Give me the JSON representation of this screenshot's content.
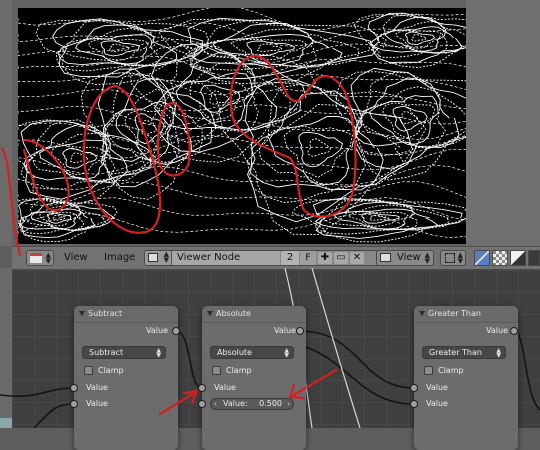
{
  "image_editor": {
    "header": {
      "menus": [
        "View",
        "Image"
      ],
      "image_name": "Viewer Node",
      "users_count": "2",
      "fake_user": "F",
      "view_dropdown": "View"
    },
    "icons": {
      "editor_type": "image-editor-icon",
      "image_browse": "image-browse-icon",
      "new_image": "plus-icon",
      "open_image": "folder-icon",
      "unlink": "close-icon",
      "view": "view-icon",
      "draw_mode": "sample-icon",
      "channels": [
        "color-alpha-channel-icon",
        "alpha-channel-icon",
        "z-buffer-icon",
        "scopes-icon"
      ]
    }
  },
  "nodes": {
    "subtract": {
      "title": "Subtract",
      "output": "Value",
      "operation": "Subtract",
      "clamp_label": "Clamp",
      "inputs": [
        "Value",
        "Value"
      ]
    },
    "absolute": {
      "title": "Absolute",
      "output": "Value",
      "operation": "Absolute",
      "clamp_label": "Clamp",
      "input": "Value",
      "value_field": {
        "label": "Value:",
        "value": "0.500"
      }
    },
    "greater_than": {
      "title": "Greater Than",
      "output": "Value",
      "operation": "Greater Than",
      "clamp_label": "Clamp",
      "inputs": [
        "Value",
        "Value"
      ]
    }
  },
  "colors": {
    "annotation": "#d42020",
    "contour": "#ffffff",
    "viewer_bg": "#000000",
    "node_grid_bg": "#3f3f3f",
    "node_body": "#6c6c6c",
    "socket_gray": "#a1a1a1"
  }
}
